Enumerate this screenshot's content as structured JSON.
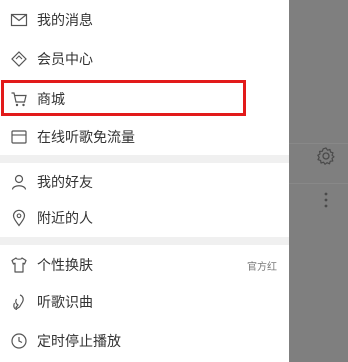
{
  "menu": {
    "messages": {
      "label": "我的消息",
      "icon": "mail-icon"
    },
    "member": {
      "label": "会员中心",
      "icon": "diamond-icon"
    },
    "store": {
      "label": "商城",
      "icon": "cart-icon"
    },
    "free_data": {
      "label": "在线听歌免流量",
      "icon": "sim-card-icon"
    },
    "friends": {
      "label": "我的好友",
      "icon": "person-icon"
    },
    "nearby": {
      "label": "附近的人",
      "icon": "location-icon"
    },
    "skin": {
      "label": "个性换肤",
      "icon": "tshirt-icon",
      "value": "官方红"
    },
    "recognize": {
      "label": "听歌识曲",
      "icon": "microphone-icon"
    },
    "timer": {
      "label": "定时停止播放",
      "icon": "clock-icon"
    }
  },
  "colors": {
    "highlight": "#e21a1a",
    "overlay": "#7f7f7f",
    "separator": "#f0f0f0"
  }
}
